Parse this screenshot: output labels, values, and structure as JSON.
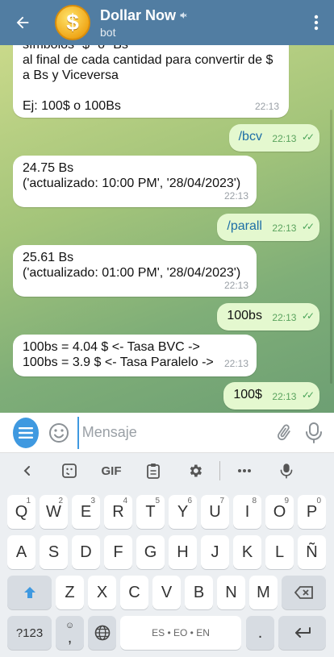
{
  "header": {
    "title": "Dollar Now",
    "subtitle": "bot",
    "avatar_symbol": "$",
    "bg": "#517da2"
  },
  "messages": [
    {
      "side": "in",
      "lines": [
        "símbolos \"$\" o \"Bs\"",
        "al final de cada cantidad para convertir de $",
        "a Bs y Viceversa",
        "",
        "Ej: 100$ o 100Bs"
      ],
      "time": "22:13"
    },
    {
      "side": "out",
      "text": "/bcv",
      "time": "22:13"
    },
    {
      "side": "in",
      "lines": [
        "24.75 Bs",
        "('actualizado: 10:00 PM', '28/04/2023')"
      ],
      "time": "22:13"
    },
    {
      "side": "out",
      "text": "/parall",
      "time": "22:13"
    },
    {
      "side": "in",
      "lines": [
        "25.61 Bs",
        "('actualizado: 01:00 PM', '28/04/2023')"
      ],
      "time": "22:13"
    },
    {
      "side": "out",
      "text": "100bs",
      "time": "22:13"
    },
    {
      "side": "in",
      "lines": [
        "100bs = 4.04 $  <- Tasa BVC ->",
        "100bs = 3.9 $  <- Tasa Paralelo ->"
      ],
      "time": "22:13"
    },
    {
      "side": "out",
      "text": "100$",
      "time": "22:13"
    }
  ],
  "input": {
    "placeholder": "Mensaje",
    "value": ""
  },
  "keyboard": {
    "toolbar": [
      "back",
      "sticker",
      "GIF",
      "clipboard",
      "settings",
      "more",
      "mic"
    ],
    "row1": [
      {
        "k": "Q",
        "h": "1"
      },
      {
        "k": "W",
        "h": "2"
      },
      {
        "k": "E",
        "h": "3"
      },
      {
        "k": "R",
        "h": "4"
      },
      {
        "k": "T",
        "h": "5"
      },
      {
        "k": "Y",
        "h": "6"
      },
      {
        "k": "U",
        "h": "7"
      },
      {
        "k": "I",
        "h": "8"
      },
      {
        "k": "O",
        "h": "9"
      },
      {
        "k": "P",
        "h": "0"
      }
    ],
    "row2": [
      "A",
      "S",
      "D",
      "F",
      "G",
      "H",
      "J",
      "K",
      "L",
      "Ñ"
    ],
    "row3": [
      "Z",
      "X",
      "C",
      "V",
      "B",
      "N",
      "M"
    ],
    "row4": {
      "sym": "?123",
      "comma": ",",
      "space": "ES • EO • EN",
      "period": "."
    }
  }
}
